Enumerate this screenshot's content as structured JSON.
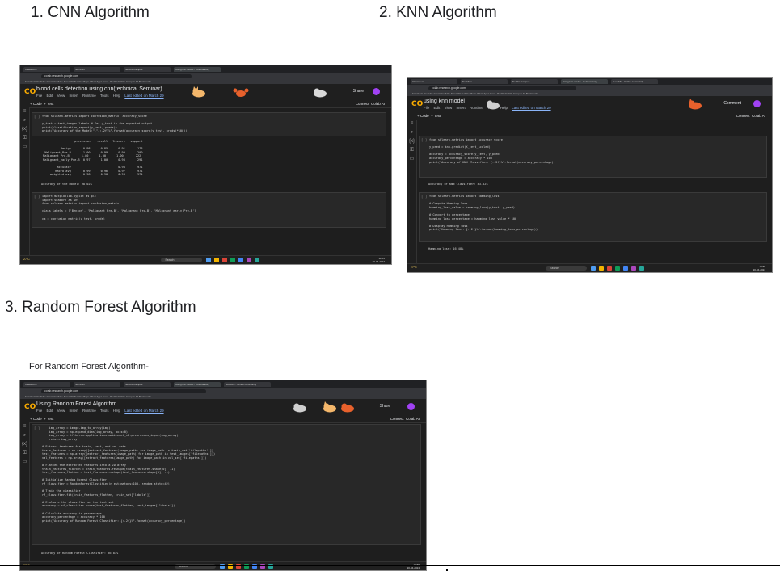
{
  "headings": {
    "cnn": "1.  CNN Algorithm",
    "knn": "2. KNN Algorithm",
    "rf": "3. Random Forest Algorithm",
    "rf_note": "For Random Forest Algorithm-"
  },
  "browser": {
    "tabs": [
      "Classroom",
      "Nai Mein",
      "NetFlix Campus",
      "Using knn model - Colaboratory",
      "GoodMe - Online community"
    ],
    "bookmarks": "Facebook  YouTube  Gmail  YouTube  News  TY-TechCo  Maps  WhatsApp  Home - Reddit  NetFlix Campus  All Bookmarks",
    "url": "colab.research.google.com",
    "share": "Share",
    "menu": [
      "File",
      "Edit",
      "View",
      "Insert",
      "Runtime",
      "Tools",
      "Help"
    ],
    "last_edited": "Last edited on March 29",
    "code_btn": "+ Code",
    "text_btn": "+ Text",
    "connect": "Connect",
    "gemini": "Colab AI",
    "search": "Search",
    "weather": "27°C",
    "time": "12:55",
    "date": "20-04-2024"
  },
  "cnn": {
    "title": "blood cells detection using cnn(technical Seminar)",
    "cell1": [
      "from sklearn.metrics import confusion_matrix, accuracy_score",
      "",
      "y_test = test_images.labels # Get y_test in the expected output",
      "print(classification_report(y_test, preds))",
      "print(\"Accuracy of the Model:\",\"{:.2f}%\".format(accuracy_score(y_test, preds)*100))"
    ],
    "report": [
      "                   precision    recall  f1-score   support",
      "",
      "           Benign       0.98      0.85      0.91       173",
      "  Malignant_Pre-B       1.00      0.99      0.99       200",
      " Malignant_Pro-B       1.00      1.00      1.00       222",
      " Malignant_early Pre-B  0.97      1.00      0.98       291",
      "",
      "         accuracy                           0.98       971",
      "        macro avg       0.99      0.96      0.97       971",
      "     weighted avg       0.98      0.98      0.98       971"
    ],
    "accuracy": "Accuracy of the Model: 98.02%",
    "cell2": [
      "import matplotlib.pyplot as plt",
      "import seaborn as sns",
      "from sklearn.metrics import confusion_matrix",
      "",
      "class_labels = ['Benign', 'Malignant_Pre-B', 'Malignant_Pro-B', 'Malignant_early Pre-B']",
      "",
      "cm = confusion_matrix(y_test, preds)"
    ]
  },
  "knn": {
    "title": "using knn model",
    "comment": "Comment",
    "cell1": [
      "from sklearn.metrics import accuracy_score",
      "",
      "y_pred = knn.predict(X_test_scaled)",
      "",
      "accuracy = accuracy_score(y_test, y_pred)",
      "accuracy_percentage = accuracy * 100",
      "print(\"Accuracy of KNN Classifier: {:.2f}%\".format(accuracy_percentage))"
    ],
    "out1": "Accuracy of KNN Classifier: 83.52%",
    "cell2": [
      "from sklearn.metrics import hamming_loss",
      "",
      "# Compute Hamming loss",
      "hamming_loss_value = hamming_loss(y_test, y_pred)",
      "",
      "# Convert to percentage",
      "hamming_loss_percentage = hamming_loss_value * 100",
      "",
      "# Display Hamming loss",
      "print(\"Hamming loss: {:.2f}%\".format(hamming_loss_percentage))"
    ],
    "out2": "Hamming loss: 16.48%"
  },
  "rf": {
    "title": "Using Random Forest Algorithm",
    "cell1": [
      "    img_array = image.img_to_array(img)",
      "    img_array = np.expand_dims(img_array, axis=0)",
      "    img_array = tf.keras.applications.mobilenet_v2.preprocess_input(img_array)",
      "    return img_array",
      "",
      "# Extract features for train, test, and val sets",
      "train_features = np.array([extract_features(image_path) for image_path in train_set['filepaths']])",
      "test_features = np.array([extract_features(image_path) for image_path in test_images['filepaths']])",
      "val_features = np.array([extract_features(image_path) for image_path in val_set['filepaths']])",
      "",
      "# Flatten the extracted features into a 2D array",
      "train_features_flatten = train_features.reshape(train_features.shape[0], -1)",
      "test_features_flatten = test_features.reshape(test_features.shape[0], -1)",
      "",
      "# Initialize Random Forest Classifier",
      "rf_classifier = RandomForestClassifier(n_estimators=100, random_state=42)",
      "",
      "# Train the classifier",
      "rf_classifier.fit(train_features_flatten, train_set['labels'])",
      "",
      "# Evaluate the classifier on the test set",
      "accuracy = rf_classifier.score(test_features_flatten, test_images['labels'])",
      "",
      "# Calculate accuracy in percentage",
      "accuracy_percentage = accuracy * 100",
      "print(\"Accuracy of Random Forest Classifier: {:.2f}%\".format(accuracy_percentage))"
    ],
    "out1": "Accuracy of Random Forest Classifier: 86.81%"
  }
}
